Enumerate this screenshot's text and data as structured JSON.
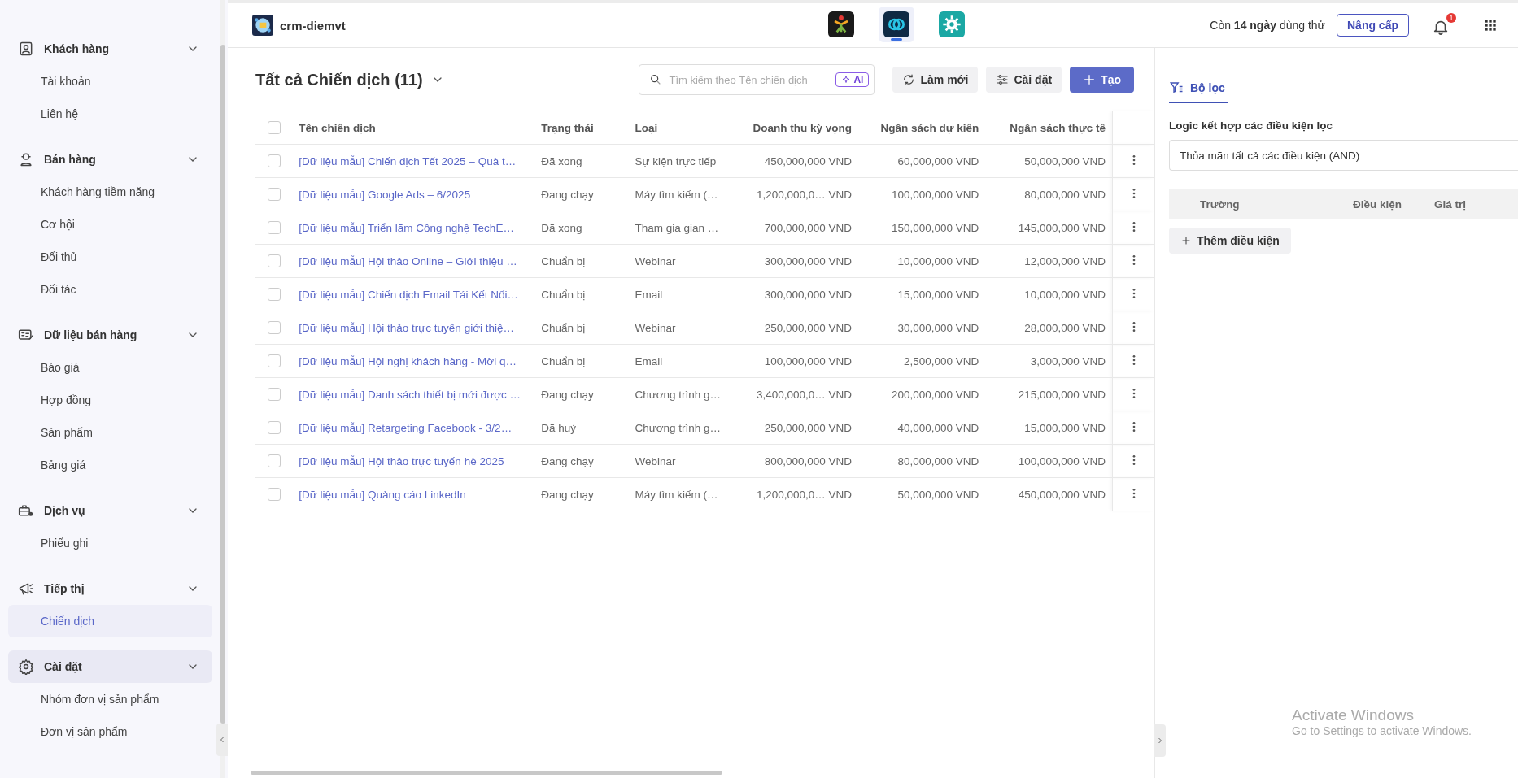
{
  "sidebar": {
    "sections": [
      {
        "title": "Khách hàng",
        "highlighted": false,
        "items": [
          {
            "label": "Tài khoản",
            "selected": false
          },
          {
            "label": "Liên hệ",
            "selected": false
          }
        ]
      },
      {
        "title": "Bán hàng",
        "highlighted": false,
        "items": [
          {
            "label": "Khách hàng tiềm năng",
            "selected": false
          },
          {
            "label": "Cơ hội",
            "selected": false
          },
          {
            "label": "Đối thủ",
            "selected": false
          },
          {
            "label": "Đối tác",
            "selected": false
          }
        ]
      },
      {
        "title": "Dữ liệu bán hàng",
        "highlighted": false,
        "items": [
          {
            "label": "Báo giá",
            "selected": false
          },
          {
            "label": "Hợp đồng",
            "selected": false
          },
          {
            "label": "Sản phẩm",
            "selected": false
          },
          {
            "label": "Bảng giá",
            "selected": false
          }
        ]
      },
      {
        "title": "Dịch vụ",
        "highlighted": false,
        "items": [
          {
            "label": "Phiếu ghi",
            "selected": false
          }
        ]
      },
      {
        "title": "Tiếp thị",
        "highlighted": false,
        "items": [
          {
            "label": "Chiến dịch",
            "selected": true
          }
        ]
      },
      {
        "title": "Cài đặt",
        "highlighted": true,
        "items": [
          {
            "label": "Nhóm đơn vị sản phẩm",
            "selected": false
          },
          {
            "label": "Đơn vị sản phẩm",
            "selected": false
          }
        ]
      }
    ]
  },
  "topbar": {
    "workspace": "crm-diemvt",
    "apps": [
      {
        "selected": false
      },
      {
        "selected": true
      },
      {
        "selected": false
      }
    ],
    "trial": "Còn **14 ngày** dùng thử",
    "upgrade": "Nâng cấp",
    "notifications": "1"
  },
  "main": {
    "title": "Tất cả Chiến dịch (11)",
    "search": {
      "placeholder": "Tìm kiếm theo Tên chiến dịch",
      "ai": "AI"
    },
    "buttons": [
      {
        "label": "Làm mới",
        "kind": "refresh"
      },
      {
        "label": "Cài đặt",
        "kind": "settings"
      },
      {
        "label": "Tạo",
        "kind": "create"
      }
    ]
  },
  "table": {
    "header_checked": false,
    "columns": [
      "Tên chiến dịch",
      "Trạng thái",
      "Loại",
      "Doanh thu kỳ vọng",
      "Ngân sách dự kiến",
      "Ngân sách thực tế"
    ],
    "rows": [
      {
        "checked": false,
        "cells": [
          "[Dữ liệu mẫu] Chiến dịch Tết 2025 – Quà t…",
          "Đã xong",
          "Sự kiện trực tiếp",
          "450,000,000 VND",
          "60,000,000 VND",
          "50,000,000 VND"
        ]
      },
      {
        "checked": false,
        "cells": [
          "[Dữ liệu mẫu] Google Ads – 6/2025",
          "Đang chạy",
          "Máy tìm kiếm (…",
          "1,200,000,0… VND",
          "100,000,000 VND",
          "80,000,000 VND"
        ]
      },
      {
        "checked": false,
        "cells": [
          "[Dữ liệu mẫu] Triển lãm Công nghệ TechE…",
          "Đã xong",
          "Tham gia gian …",
          "700,000,000 VND",
          "150,000,000 VND",
          "145,000,000 VND"
        ]
      },
      {
        "checked": false,
        "cells": [
          "[Dữ liệu mẫu] Hội thảo Online – Giới thiệu …",
          "Chuẩn bị",
          "Webinar",
          "300,000,000 VND",
          "10,000,000 VND",
          "12,000,000 VND"
        ]
      },
      {
        "checked": false,
        "cells": [
          "[Dữ liệu mẫu] Chiến dịch Email Tái Kết Nối…",
          "Chuẩn bị",
          "Email",
          "300,000,000 VND",
          "15,000,000 VND",
          "10,000,000 VND"
        ]
      },
      {
        "checked": false,
        "cells": [
          "[Dữ liệu mẫu] Hội thảo trực tuyến giới thiệ…",
          "Chuẩn bị",
          "Webinar",
          "250,000,000 VND",
          "30,000,000 VND",
          "28,000,000 VND"
        ]
      },
      {
        "checked": false,
        "cells": [
          "[Dữ liệu mẫu] Hội nghị khách hàng - Mời q…",
          "Chuẩn bị",
          "Email",
          "100,000,000 VND",
          "2,500,000 VND",
          "3,000,000 VND"
        ]
      },
      {
        "checked": false,
        "cells": [
          "[Dữ liệu mẫu] Danh sách thiết bị mới được …",
          "Đang chạy",
          "Chương trình g…",
          "3,400,000,0… VND",
          "200,000,000 VND",
          "215,000,000 VND"
        ]
      },
      {
        "checked": false,
        "cells": [
          "[Dữ liệu mẫu] Retargeting Facebook - 3/2…",
          "Đã huỷ",
          "Chương trình g…",
          "250,000,000 VND",
          "40,000,000 VND",
          "15,000,000 VND"
        ]
      },
      {
        "checked": false,
        "cells": [
          "[Dữ liệu mẫu] Hội thảo trực tuyến hè 2025",
          "Đang chạy",
          "Webinar",
          "800,000,000 VND",
          "80,000,000 VND",
          "100,000,000 VND"
        ]
      },
      {
        "checked": false,
        "cells": [
          "[Dữ liệu mẫu] Quảng cáo LinkedIn",
          "Đang chạy",
          "Máy tìm kiếm (…",
          "1,200,000,0… VND",
          "50,000,000 VND",
          "450,000,000 VND"
        ]
      }
    ]
  },
  "filter_panel": {
    "tab": {
      "label": "Bộ lọc",
      "selected": true
    },
    "logic_label": "Logic kết hợp các điều kiện lọc",
    "logic_value": "Thỏa mãn tất cả các điều kiện (AND)",
    "columns": [
      "Trường",
      "Điều kiện",
      "Giá trị"
    ],
    "add_button": "Thêm điều kiện"
  },
  "watermark": {
    "title": "Activate Windows",
    "subtitle": "Go to Settings to activate Windows."
  }
}
